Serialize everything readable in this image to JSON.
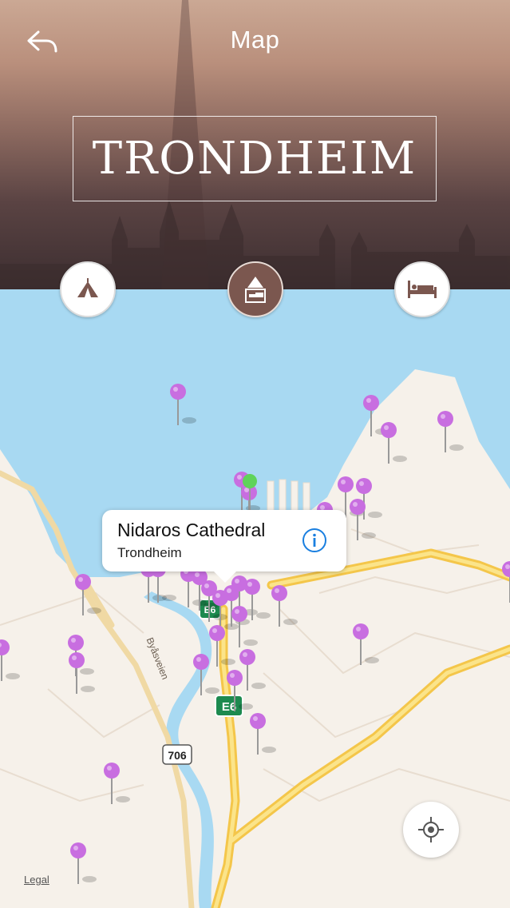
{
  "header": {
    "title": "Map",
    "city": "TRONDHEIM",
    "back_icon": "back-arrow-icon"
  },
  "categories": [
    {
      "name": "tent-icon",
      "active": false
    },
    {
      "name": "hotel-icon",
      "active": true
    },
    {
      "name": "bed-icon",
      "active": false
    }
  ],
  "callout": {
    "title": "Nidaros Cathedral",
    "subtitle": "Trondheim",
    "icon": "info-icon"
  },
  "map": {
    "legal": "Legal",
    "road_labels": {
      "street": "Byåsveien",
      "route": "706",
      "e6_a": "E6",
      "e6_b": "E6"
    },
    "pin_color": "#c86ee0",
    "selected_pin_color": "#5fd35a",
    "locate_icon": "location-target-icon"
  }
}
